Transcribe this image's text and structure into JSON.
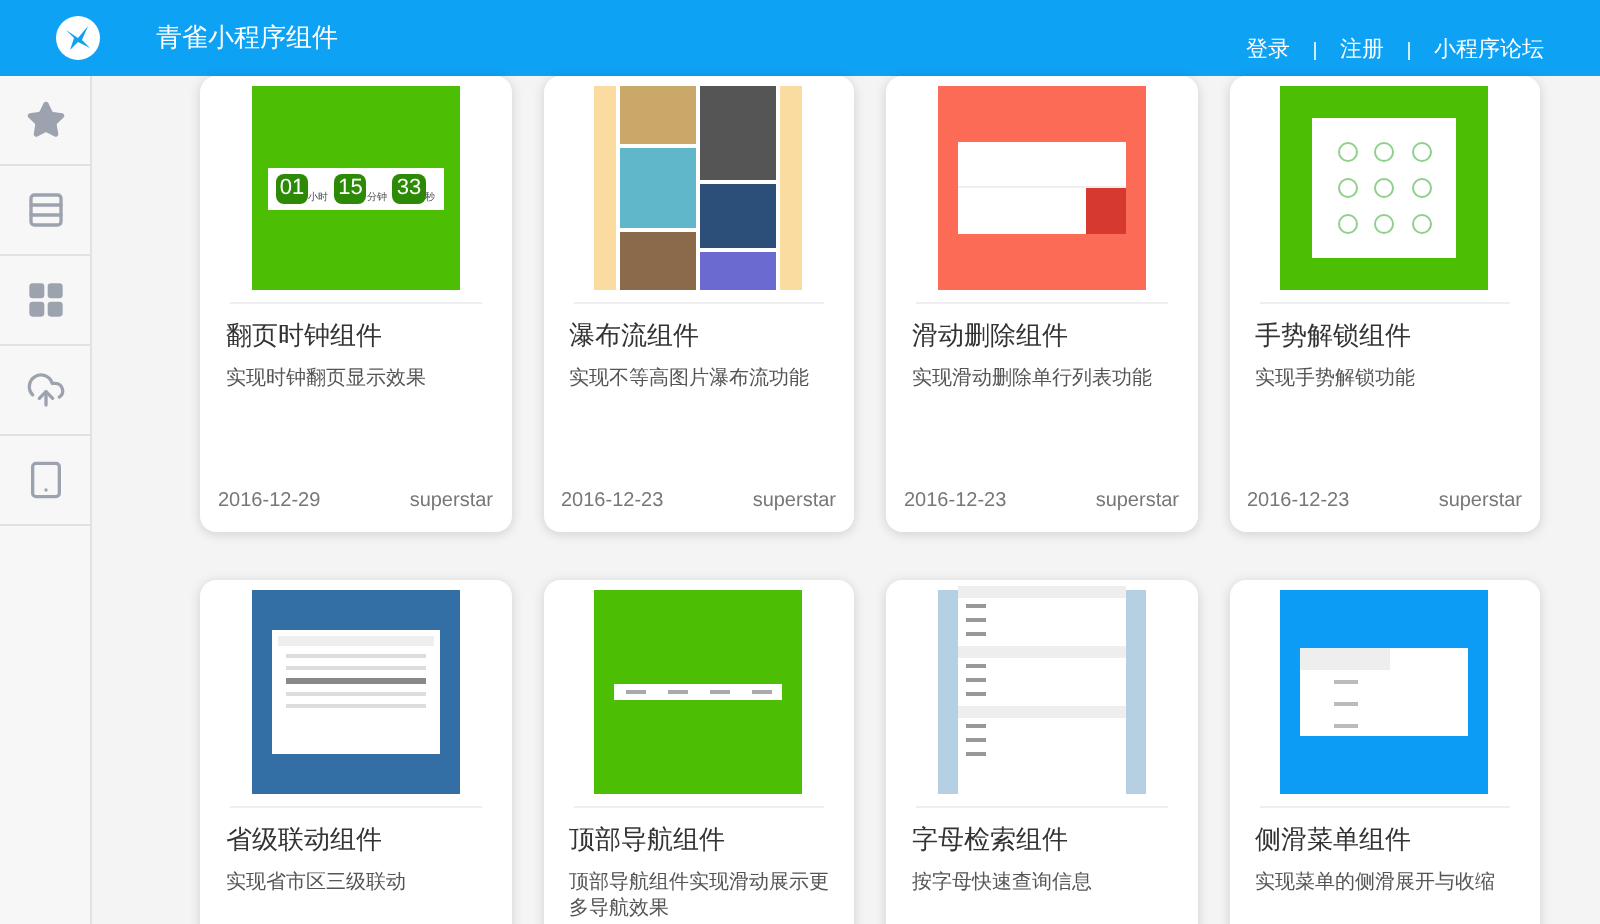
{
  "header": {
    "title": "青雀小程序组件",
    "links": [
      "登录",
      "注册",
      "小程序论坛"
    ]
  },
  "sidebar": {
    "items": [
      {
        "kind": "star"
      },
      {
        "kind": "list"
      },
      {
        "kind": "grid"
      },
      {
        "kind": "upload"
      },
      {
        "kind": "tablet"
      }
    ]
  },
  "cards": [
    {
      "kind": "clock",
      "color": "#4cbf05",
      "digits": [
        {
          "value": "01",
          "unit": "小时"
        },
        {
          "value": "15",
          "unit": "分钟"
        },
        {
          "value": "33",
          "unit": "秒"
        }
      ],
      "title": "翻页时钟组件",
      "description": "实现时钟翻页显示效果",
      "date": "2016-12-29",
      "author": "superstar"
    },
    {
      "kind": "waterfall",
      "color": "#fbdca0",
      "title": "瀑布流组件",
      "description": "实现不等高图片瀑布流功能",
      "date": "2016-12-23",
      "author": "superstar"
    },
    {
      "kind": "swipe",
      "color": "#fb6b55",
      "title": "滑动删除组件",
      "description": "实现滑动删除单行列表功能",
      "date": "2016-12-23",
      "author": "superstar"
    },
    {
      "kind": "gesture",
      "color": "#4cbf05",
      "title": "手势解锁组件",
      "description": "实现手势解锁功能",
      "date": "2016-12-23",
      "author": "superstar"
    },
    {
      "kind": "picker",
      "color": "#336fa5",
      "title": "省级联动组件",
      "description": "实现省市区三级联动"
    },
    {
      "kind": "nav",
      "color": "#4cbf05",
      "title": "顶部导航组件",
      "description": "顶部导航组件实现滑动展示更多导航效果"
    },
    {
      "kind": "index",
      "color": "#b5cfe3",
      "title": "字母检索组件",
      "description": "按字母快速查询信息"
    },
    {
      "kind": "drawer",
      "color": "#0d9cf5",
      "title": "侧滑菜单组件",
      "description": "实现菜单的侧滑展开与收缩"
    }
  ]
}
